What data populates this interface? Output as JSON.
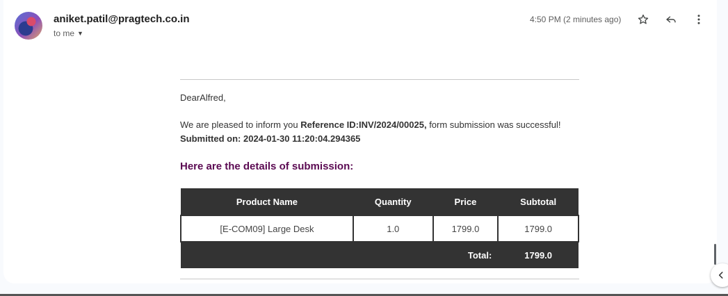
{
  "header": {
    "sender_email": "aniket.patil@pragtech.co.in",
    "recipient_label": "to me",
    "timestamp": "4:50 PM (2 minutes ago)",
    "icons": {
      "star": "star-icon",
      "reply": "reply-icon",
      "more": "more-vert-icon",
      "expand": "chevron-down-icon"
    }
  },
  "email_body": {
    "greeting": "DearAlfred,",
    "intro_prefix": "We are pleased to inform you ",
    "reference_label": "Reference ID:INV/2024/00025,",
    "intro_suffix": " form submission was successful!",
    "submitted_on": "Submitted on: 2024-01-30 11:20:04.294365",
    "details_heading": "Here are the details of submission:",
    "heading_color": "#5b0a52"
  },
  "table": {
    "headers": [
      "Product Name",
      "Quantity",
      "Price",
      "Subtotal"
    ],
    "rows": [
      [
        "[E-COM09] Large Desk",
        "1.0",
        "1799.0",
        "1799.0"
      ]
    ],
    "total_label": "Total:",
    "total_value": "1799.0",
    "header_bg": "#333333"
  },
  "side_panel": {
    "toggle_icon": "chevron-left-icon"
  }
}
